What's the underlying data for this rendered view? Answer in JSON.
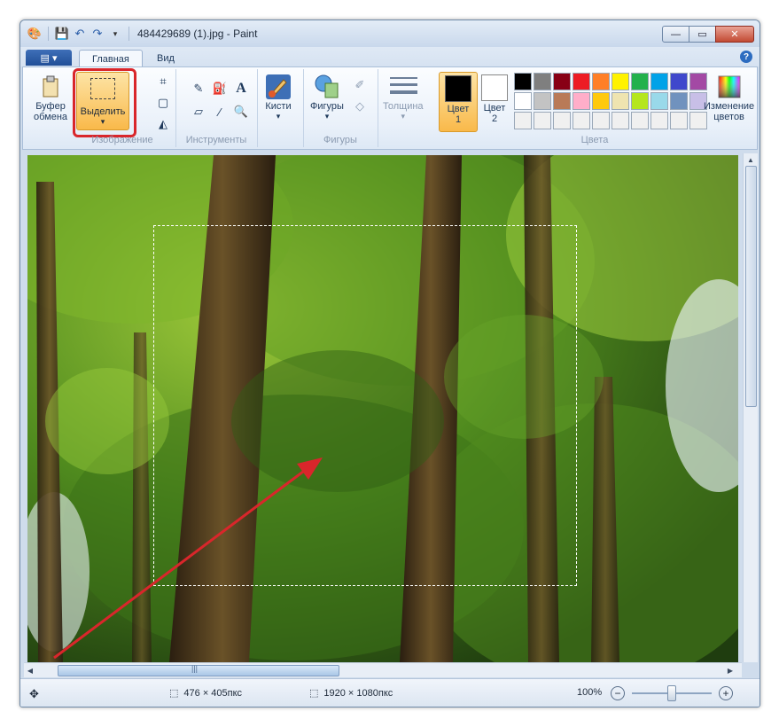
{
  "window": {
    "title": "484429689 (1).jpg - Paint",
    "controls": {
      "minimize": "—",
      "maximize": "▭",
      "close": "✕"
    }
  },
  "ribbon_tabs": {
    "file": "▤ ▾",
    "home": "Главная",
    "view": "Вид",
    "help": "?"
  },
  "clipboard": {
    "label_line1": "Буфер",
    "label_line2": "обмена"
  },
  "image_group": {
    "select_label": "Выделить",
    "select_arrow": "▾",
    "group_label": "Изображение"
  },
  "tools_group": {
    "group_label": "Инструменты"
  },
  "brushes": {
    "label": "Кисти",
    "arrow": "▾"
  },
  "shapes": {
    "label": "Фигуры",
    "arrow": "▾",
    "group_label": "Фигуры"
  },
  "thickness": {
    "label": "Толщина",
    "arrow": "▾"
  },
  "colors": {
    "color1_line1": "Цвет",
    "color1_line2": "1",
    "color2_line1": "Цвет",
    "color2_line2": "2",
    "edit_line1": "Изменение",
    "edit_line2": "цветов",
    "group_label": "Цвета",
    "color1_value": "#000000",
    "color2_value": "#ffffff",
    "palette": [
      "#000000",
      "#7f7f7f",
      "#880015",
      "#ed1c24",
      "#ff7f27",
      "#fff200",
      "#22b14c",
      "#00a2e8",
      "#3f48cc",
      "#a349a4",
      "#ffffff",
      "#c3c3c3",
      "#b97a57",
      "#ffaec9",
      "#ffc90e",
      "#efe4b0",
      "#b5e61d",
      "#99d9ea",
      "#7092be",
      "#c8bfe7",
      "#f0f0f0",
      "#f0f0f0",
      "#f0f0f0",
      "#f0f0f0",
      "#f0f0f0",
      "#f0f0f0",
      "#f0f0f0",
      "#f0f0f0",
      "#f0f0f0",
      "#f0f0f0"
    ]
  },
  "statusbar": {
    "selection_size": "476 × 405пкс",
    "image_size": "1920 × 1080пкс",
    "zoom": "100%",
    "zoom_minus": "−",
    "zoom_plus": "+"
  },
  "scroll": {
    "hthumb_grip": "|||"
  },
  "annotation": {
    "highlight_color": "#d9262b",
    "arrow_color": "#d9262b"
  }
}
